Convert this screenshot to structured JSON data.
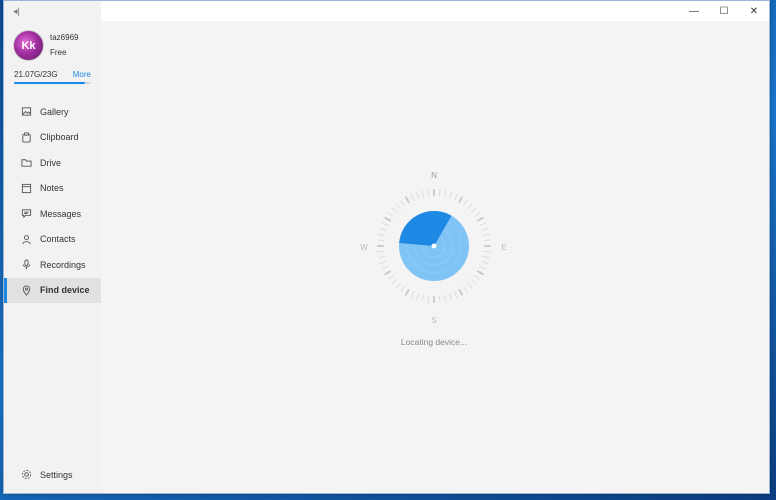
{
  "window": {
    "sidebar_toggle_glyph": "◂|",
    "controls": {
      "minimize": "—",
      "maximize": "☐",
      "close": "✕"
    }
  },
  "profile": {
    "avatar_initials": "Kk",
    "username": "taz6969",
    "plan": "Free"
  },
  "storage": {
    "used_label": "21.07G/23G",
    "more_label": "More",
    "fill_fraction": 0.92
  },
  "nav": {
    "items": [
      {
        "label": "Gallery",
        "icon": "image-icon"
      },
      {
        "label": "Clipboard",
        "icon": "clipboard-icon"
      },
      {
        "label": "Drive",
        "icon": "folder-icon"
      },
      {
        "label": "Notes",
        "icon": "notes-icon"
      },
      {
        "label": "Messages",
        "icon": "message-icon"
      },
      {
        "label": "Contacts",
        "icon": "person-icon"
      },
      {
        "label": "Recordings",
        "icon": "microphone-icon"
      },
      {
        "label": "Find device",
        "icon": "location-pin-icon",
        "active": true
      }
    ],
    "settings_label": "Settings"
  },
  "finder": {
    "compass": {
      "north": "N",
      "east": "E",
      "south": "S",
      "west": "W"
    },
    "status": "Locating device...",
    "colors": {
      "accent": "#1e88e5",
      "accent_light": "#7fc4f5"
    }
  }
}
